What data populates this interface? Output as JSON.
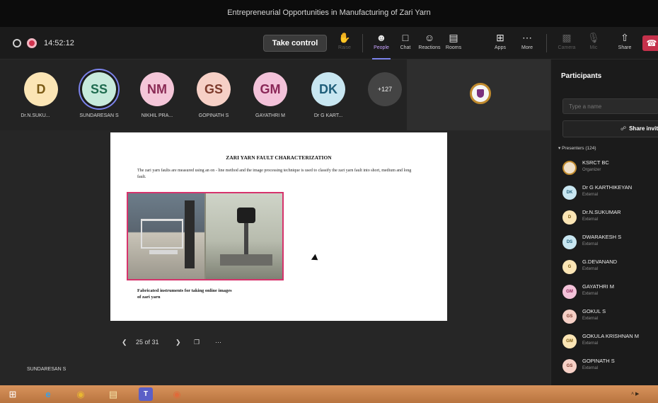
{
  "window": {
    "title": "Entrepreneurial Opportunities in Manufacturing of Zari Yarn"
  },
  "toolbar": {
    "timer": "14:52:12",
    "take_control_label": "Take control",
    "buttons": [
      {
        "label": "Raise",
        "icon": "raise-hand-icon",
        "state": "disabled"
      },
      {
        "label": "People",
        "icon": "people-icon",
        "state": "active"
      },
      {
        "label": "Chat",
        "icon": "chat-icon",
        "state": "normal"
      },
      {
        "label": "Reactions",
        "icon": "reactions-icon",
        "state": "normal"
      },
      {
        "label": "Rooms",
        "icon": "rooms-icon",
        "state": "normal"
      },
      {
        "label": "Apps",
        "icon": "apps-icon",
        "state": "normal"
      },
      {
        "label": "More",
        "icon": "more-icon",
        "state": "normal"
      },
      {
        "label": "Camera",
        "icon": "camera-icon",
        "state": "disabled"
      },
      {
        "label": "Mic",
        "icon": "mic-icon",
        "state": "disabled"
      },
      {
        "label": "Share",
        "icon": "share-icon",
        "state": "normal"
      }
    ]
  },
  "avatar_strip": {
    "people": [
      {
        "initials": "D",
        "name": "Dr.N.SUKU...",
        "bg": "#fbe5b5",
        "fg": "#7a5a14"
      },
      {
        "initials": "SS",
        "name": "SUNDARESAN S",
        "bg": "#c7eadc",
        "fg": "#1e6b4f",
        "active": true
      },
      {
        "initials": "NM",
        "name": "NIKHIL PRA...",
        "bg": "#f4c6d8",
        "fg": "#8a2b55"
      },
      {
        "initials": "GS",
        "name": "GOPINATH S",
        "bg": "#f6d0c6",
        "fg": "#7d3a2b"
      },
      {
        "initials": "GM",
        "name": "GAYATHRI M",
        "bg": "#f3c2d9",
        "fg": "#8a2758"
      },
      {
        "initials": "DK",
        "name": "Dr G KART...",
        "bg": "#c8e6f1",
        "fg": "#1f5e7a"
      }
    ],
    "overflow_count": "+127"
  },
  "slide": {
    "title": "ZARI YARN FAULT CHARACTERIZATION",
    "body": "The zari yarn faults are measured using an on - line method and the image processing technique is used to classify the zari yarn fault into short, medium and long fault.",
    "caption_line1": "Fabricated instruments for taking online images",
    "caption_line2": "of zari yarn"
  },
  "pager": {
    "position": "25 of 31"
  },
  "presenter_name": "SUNDARESAN S",
  "participants_panel": {
    "title": "Participants",
    "search_placeholder": "Type a name",
    "share_invite_label": "Share invit",
    "section_label": "Presenters (124)",
    "list": [
      {
        "initials": "",
        "name": "KSRCT BC",
        "role": "Organizer",
        "bg": "#f0e0c8",
        "fg": "#7a2f7d",
        "logo": true
      },
      {
        "initials": "DK",
        "name": "Dr G KARTHIKEYAN",
        "role": "External",
        "bg": "#c8e6f1",
        "fg": "#1f5e7a"
      },
      {
        "initials": "D",
        "name": "Dr.N.SUKUMAR",
        "role": "External",
        "bg": "#fbe5b5",
        "fg": "#7a5a14"
      },
      {
        "initials": "DS",
        "name": "DWARAKESH S",
        "role": "External",
        "bg": "#c8e6f1",
        "fg": "#1f5e7a"
      },
      {
        "initials": "G",
        "name": "G.DEVANAND",
        "role": "External",
        "bg": "#fbe5b5",
        "fg": "#7a5a14"
      },
      {
        "initials": "GM",
        "name": "GAYATHRI M",
        "role": "External",
        "bg": "#f3c2d9",
        "fg": "#8a2758"
      },
      {
        "initials": "GS",
        "name": "GOKUL S",
        "role": "External",
        "bg": "#f6d0c6",
        "fg": "#7d3a2b"
      },
      {
        "initials": "GM",
        "name": "GOKULA KRISHNAN M",
        "role": "External",
        "bg": "#fbe5b5",
        "fg": "#7a5a14"
      },
      {
        "initials": "GS",
        "name": "GOPINATH S",
        "role": "External",
        "bg": "#f6d0c6",
        "fg": "#7d3a2b"
      }
    ]
  },
  "taskbar": {
    "apps": [
      "windows-start-icon",
      "internet-explorer-icon",
      "chrome-icon",
      "file-explorer-icon",
      "teams-icon",
      "chrome-profile-icon"
    ],
    "tray_text": "˄ ▶"
  }
}
